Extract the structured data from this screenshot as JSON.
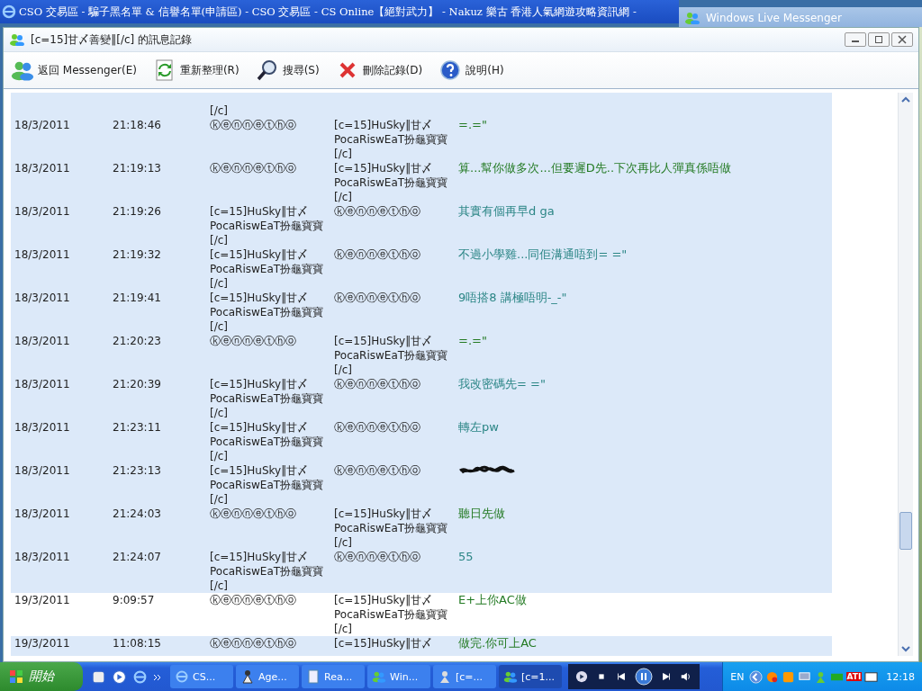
{
  "browser_title": "CSO 交易區 - 騙子黑名單 & 信譽名單(申請區) - CSO 交易區 - CS Online【絕對武力】 - Nakuz 樂古 香港人氣網遊攻略資訊網 -",
  "messenger_title": "Windows Live Messenger",
  "window": {
    "title": "[c=15]甘〆善變‖[/c] 的訊息記錄"
  },
  "toolbar": [
    {
      "kind": "back",
      "label": "返回 Messenger(E)"
    },
    {
      "kind": "refresh",
      "label": "重新整理(R)"
    },
    {
      "kind": "search",
      "label": "搜尋(S)"
    },
    {
      "kind": "delete",
      "label": "刪除記錄(D)"
    },
    {
      "kind": "help",
      "label": "說明(H)"
    }
  ],
  "partial_top": {
    "from": "[/c]"
  },
  "rows": [
    {
      "date": "18/3/2011",
      "time": "21:18:46",
      "from": "ⓚⓔⓝⓝⓔⓣⓗⓞ",
      "to": "[c=15]HuSky‖甘〆\nPocaRiswEaT扮龜寶寶\n[/c]",
      "message": "=.=\"",
      "color": "#237a23",
      "selected": true
    },
    {
      "date": "18/3/2011",
      "time": "21:19:13",
      "from": "ⓚⓔⓝⓝⓔⓣⓗⓞ",
      "to": "[c=15]HuSky‖甘〆\nPocaRiswEaT扮龜寶寶\n[/c]",
      "message": "算...幫你做多次...但要遲D先..下次再比人彈真係唔做",
      "color": "#237a23",
      "selected": true
    },
    {
      "date": "18/3/2011",
      "time": "21:19:26",
      "from": "[c=15]HuSky‖甘〆\nPocaRiswEaT扮龜寶寶\n[/c]",
      "to": "ⓚⓔⓝⓝⓔⓣⓗⓞ",
      "message": "其實有個再早d ga",
      "color": "#2a8585",
      "selected": true
    },
    {
      "date": "18/3/2011",
      "time": "21:19:32",
      "from": "[c=15]HuSky‖甘〆\nPocaRiswEaT扮龜寶寶\n[/c]",
      "to": "ⓚⓔⓝⓝⓔⓣⓗⓞ",
      "message": "不過小學雞...同佢溝通唔到= =\"",
      "color": "#2a8585",
      "selected": true
    },
    {
      "date": "18/3/2011",
      "time": "21:19:41",
      "from": "[c=15]HuSky‖甘〆\nPocaRiswEaT扮龜寶寶\n[/c]",
      "to": "ⓚⓔⓝⓝⓔⓣⓗⓞ",
      "message": "9唔搭8 講極唔明-_-\"",
      "color": "#2a8585",
      "selected": true
    },
    {
      "date": "18/3/2011",
      "time": "21:20:23",
      "from": "ⓚⓔⓝⓝⓔⓣⓗⓞ",
      "to": "[c=15]HuSky‖甘〆\nPocaRiswEaT扮龜寶寶\n[/c]",
      "message": "=.=\"",
      "color": "#237a23",
      "selected": true
    },
    {
      "date": "18/3/2011",
      "time": "21:20:39",
      "from": "[c=15]HuSky‖甘〆\nPocaRiswEaT扮龜寶寶\n[/c]",
      "to": "ⓚⓔⓝⓝⓔⓣⓗⓞ",
      "message": "我改密碼先= =\"",
      "color": "#2a8585",
      "selected": true
    },
    {
      "date": "18/3/2011",
      "time": "21:23:11",
      "from": "[c=15]HuSky‖甘〆\nPocaRiswEaT扮龜寶寶\n[/c]",
      "to": "ⓚⓔⓝⓝⓔⓣⓗⓞ",
      "message": "轉左pw",
      "color": "#2a8585",
      "selected": true
    },
    {
      "date": "18/3/2011",
      "time": "21:23:13",
      "from": "[c=15]HuSky‖甘〆\nPocaRiswEaT扮龜寶寶\n[/c]",
      "to": "ⓚⓔⓝⓝⓔⓣⓗⓞ",
      "redacted": true,
      "selected": true
    },
    {
      "date": "18/3/2011",
      "time": "21:24:03",
      "from": "ⓚⓔⓝⓝⓔⓣⓗⓞ",
      "to": "[c=15]HuSky‖甘〆\nPocaRiswEaT扮龜寶寶\n[/c]",
      "message": "聽日先做",
      "color": "#237a23",
      "selected": true
    },
    {
      "date": "18/3/2011",
      "time": "21:24:07",
      "from": "[c=15]HuSky‖甘〆\nPocaRiswEaT扮龜寶寶\n[/c]",
      "to": "ⓚⓔⓝⓝⓔⓣⓗⓞ",
      "message": "55",
      "color": "#2a8585",
      "selected": true
    },
    {
      "date": "19/3/2011",
      "time": "9:09:57",
      "from": "ⓚⓔⓝⓝⓔⓣⓗⓞ",
      "to": "[c=15]HuSky‖甘〆\nPocaRiswEaT扮龜寶寶\n[/c]",
      "message": "E+上你AC做",
      "color": "#237a23",
      "selected": false
    },
    {
      "date": "19/3/2011",
      "time": "11:08:15",
      "from": "ⓚⓔⓝⓝⓔⓣⓗⓞ",
      "to": "[c=15]HuSky‖甘〆",
      "message": "做完.你可上AC",
      "color": "#237a23",
      "selected": true
    }
  ],
  "taskbar": {
    "start": "開始",
    "tasks": [
      {
        "kind": "ie",
        "label": "CS...",
        "selected": false
      },
      {
        "kind": "agent",
        "label": "Age...",
        "selected": false
      },
      {
        "kind": "doc",
        "label": "Rea...",
        "selected": false
      },
      {
        "kind": "msn",
        "label": "Win...",
        "selected": false
      },
      {
        "kind": "people",
        "label": "[c=...",
        "selected": false
      },
      {
        "kind": "msn",
        "label": "[c=1...",
        "selected": true
      }
    ],
    "language": "EN",
    "ati": "ATI",
    "clock": "12:18"
  }
}
